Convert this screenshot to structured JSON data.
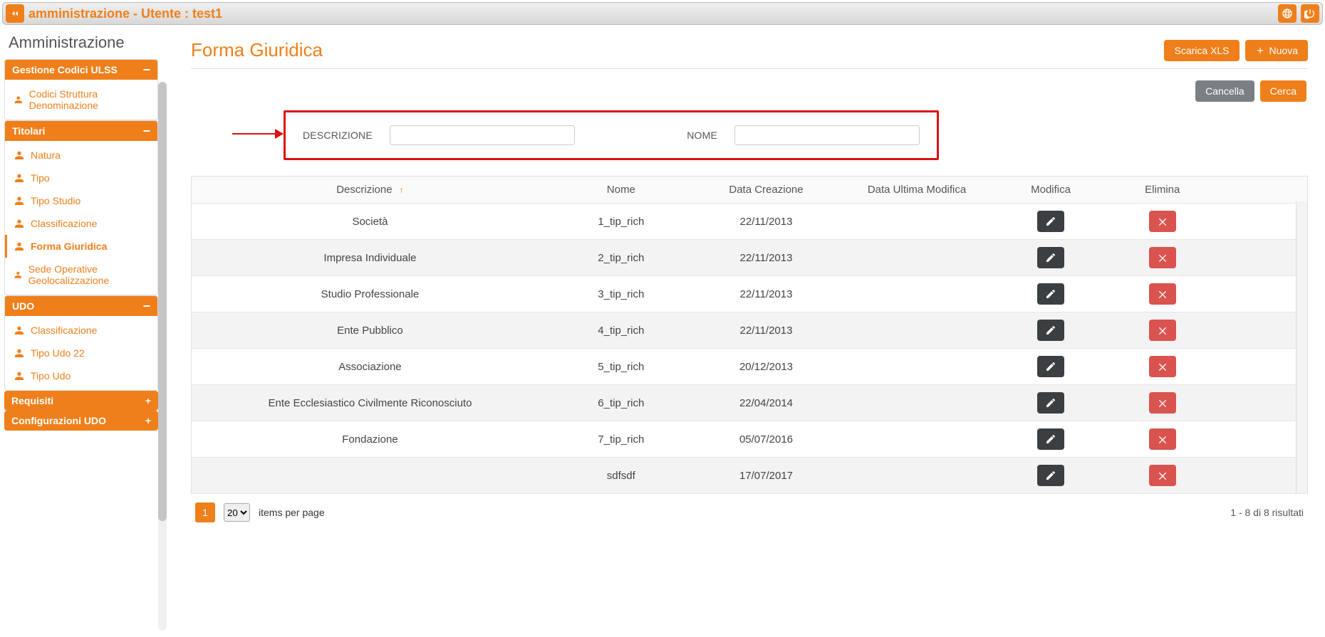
{
  "topbar": {
    "title": "amministrazione - Utente : test1"
  },
  "sidebar": {
    "title": "Amministrazione",
    "groups": [
      {
        "label": "Gestione Codici ULSS",
        "open": true,
        "toggle": "−",
        "items": [
          {
            "label": "Codici Struttura Denominazione",
            "active": false
          }
        ]
      },
      {
        "label": "Titolari",
        "open": true,
        "toggle": "−",
        "items": [
          {
            "label": "Natura",
            "active": false
          },
          {
            "label": "Tipo",
            "active": false
          },
          {
            "label": "Tipo Studio",
            "active": false
          },
          {
            "label": "Classificazione",
            "active": false
          },
          {
            "label": "Forma Giuridica",
            "active": true
          },
          {
            "label": "Sede Operative Geolocalizzazione",
            "active": false
          }
        ]
      },
      {
        "label": "UDO",
        "open": true,
        "toggle": "−",
        "items": [
          {
            "label": "Classificazione",
            "active": false
          },
          {
            "label": "Tipo Udo 22",
            "active": false
          },
          {
            "label": "Tipo Udo",
            "active": false
          }
        ]
      },
      {
        "label": "Requisiti",
        "open": false,
        "toggle": "+"
      },
      {
        "label": "Configurazioni UDO",
        "open": false,
        "toggle": "+"
      }
    ]
  },
  "page": {
    "title": "Forma Giuridica",
    "actions": {
      "download": "Scarica XLS",
      "new": "Nuova"
    },
    "toolbar": {
      "cancel": "Cancella",
      "search": "Cerca"
    },
    "filters": {
      "descrizione_label": "DESCRIZIONE",
      "descrizione_value": "",
      "nome_label": "NOME",
      "nome_value": ""
    },
    "columns": {
      "descrizione": "Descrizione",
      "nome": "Nome",
      "data_creazione": "Data Creazione",
      "data_modifica": "Data Ultima Modifica",
      "modifica": "Modifica",
      "elimina": "Elimina"
    },
    "rows": [
      {
        "descrizione": "Società",
        "nome": "1_tip_rich",
        "data_creazione": "22/11/2013",
        "data_modifica": ""
      },
      {
        "descrizione": "Impresa Individuale",
        "nome": "2_tip_rich",
        "data_creazione": "22/11/2013",
        "data_modifica": ""
      },
      {
        "descrizione": "Studio Professionale",
        "nome": "3_tip_rich",
        "data_creazione": "22/11/2013",
        "data_modifica": ""
      },
      {
        "descrizione": "Ente Pubblico",
        "nome": "4_tip_rich",
        "data_creazione": "22/11/2013",
        "data_modifica": ""
      },
      {
        "descrizione": "Associazione",
        "nome": "5_tip_rich",
        "data_creazione": "20/12/2013",
        "data_modifica": ""
      },
      {
        "descrizione": "Ente Ecclesiastico Civilmente Riconosciuto",
        "nome": "6_tip_rich",
        "data_creazione": "22/04/2014",
        "data_modifica": ""
      },
      {
        "descrizione": "Fondazione",
        "nome": "7_tip_rich",
        "data_creazione": "05/07/2016",
        "data_modifica": ""
      },
      {
        "descrizione": "",
        "nome": "sdfsdf",
        "data_creazione": "17/07/2017",
        "data_modifica": ""
      }
    ],
    "pager": {
      "current": "1",
      "page_size": "20",
      "items_label": "items per page",
      "summary": "1 - 8 di 8 risultati"
    }
  }
}
